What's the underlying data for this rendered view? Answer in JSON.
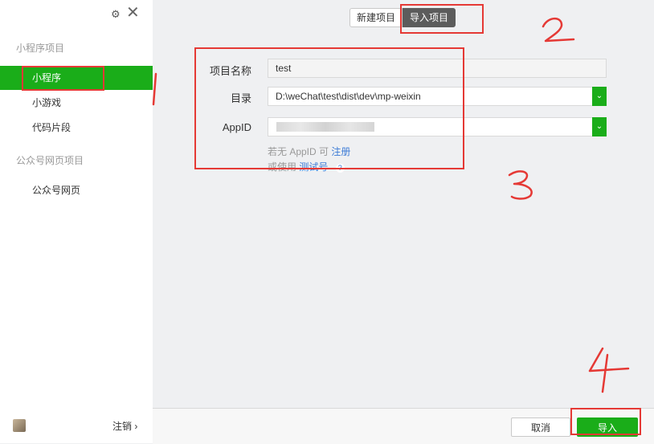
{
  "sidebar": {
    "settings_icon": "gear-icon",
    "close_icon": "close-icon",
    "sections": [
      {
        "title": "小程序项目",
        "items": [
          "小程序",
          "小游戏",
          "代码片段"
        ]
      },
      {
        "title": "公众号网页项目",
        "items": [
          "公众号网页"
        ]
      }
    ],
    "active_item": "小程序",
    "logout_label": "注销 ›"
  },
  "tabs": {
    "new_project": "新建项目",
    "import_project": "导入项目",
    "active": "导入项目"
  },
  "form": {
    "project_name_label": "项目名称",
    "project_name_value": "test",
    "directory_label": "目录",
    "directory_value": "D:\\weChat\\test\\dist\\dev\\mp-weixin",
    "appid_label": "AppID",
    "hint_line1_prefix": "若无 AppID 可",
    "hint_register_link": "注册",
    "hint_line2_prefix": "或使用",
    "hint_test_link": "测试号",
    "hint_help": "?"
  },
  "footer": {
    "cancel_label": "取消",
    "import_label": "导入"
  },
  "annotations": [
    "1",
    "2",
    "3",
    "4"
  ],
  "colors": {
    "accent_green": "#1aad19",
    "annotation_red": "#e53935",
    "link_blue": "#3c7bd6"
  }
}
